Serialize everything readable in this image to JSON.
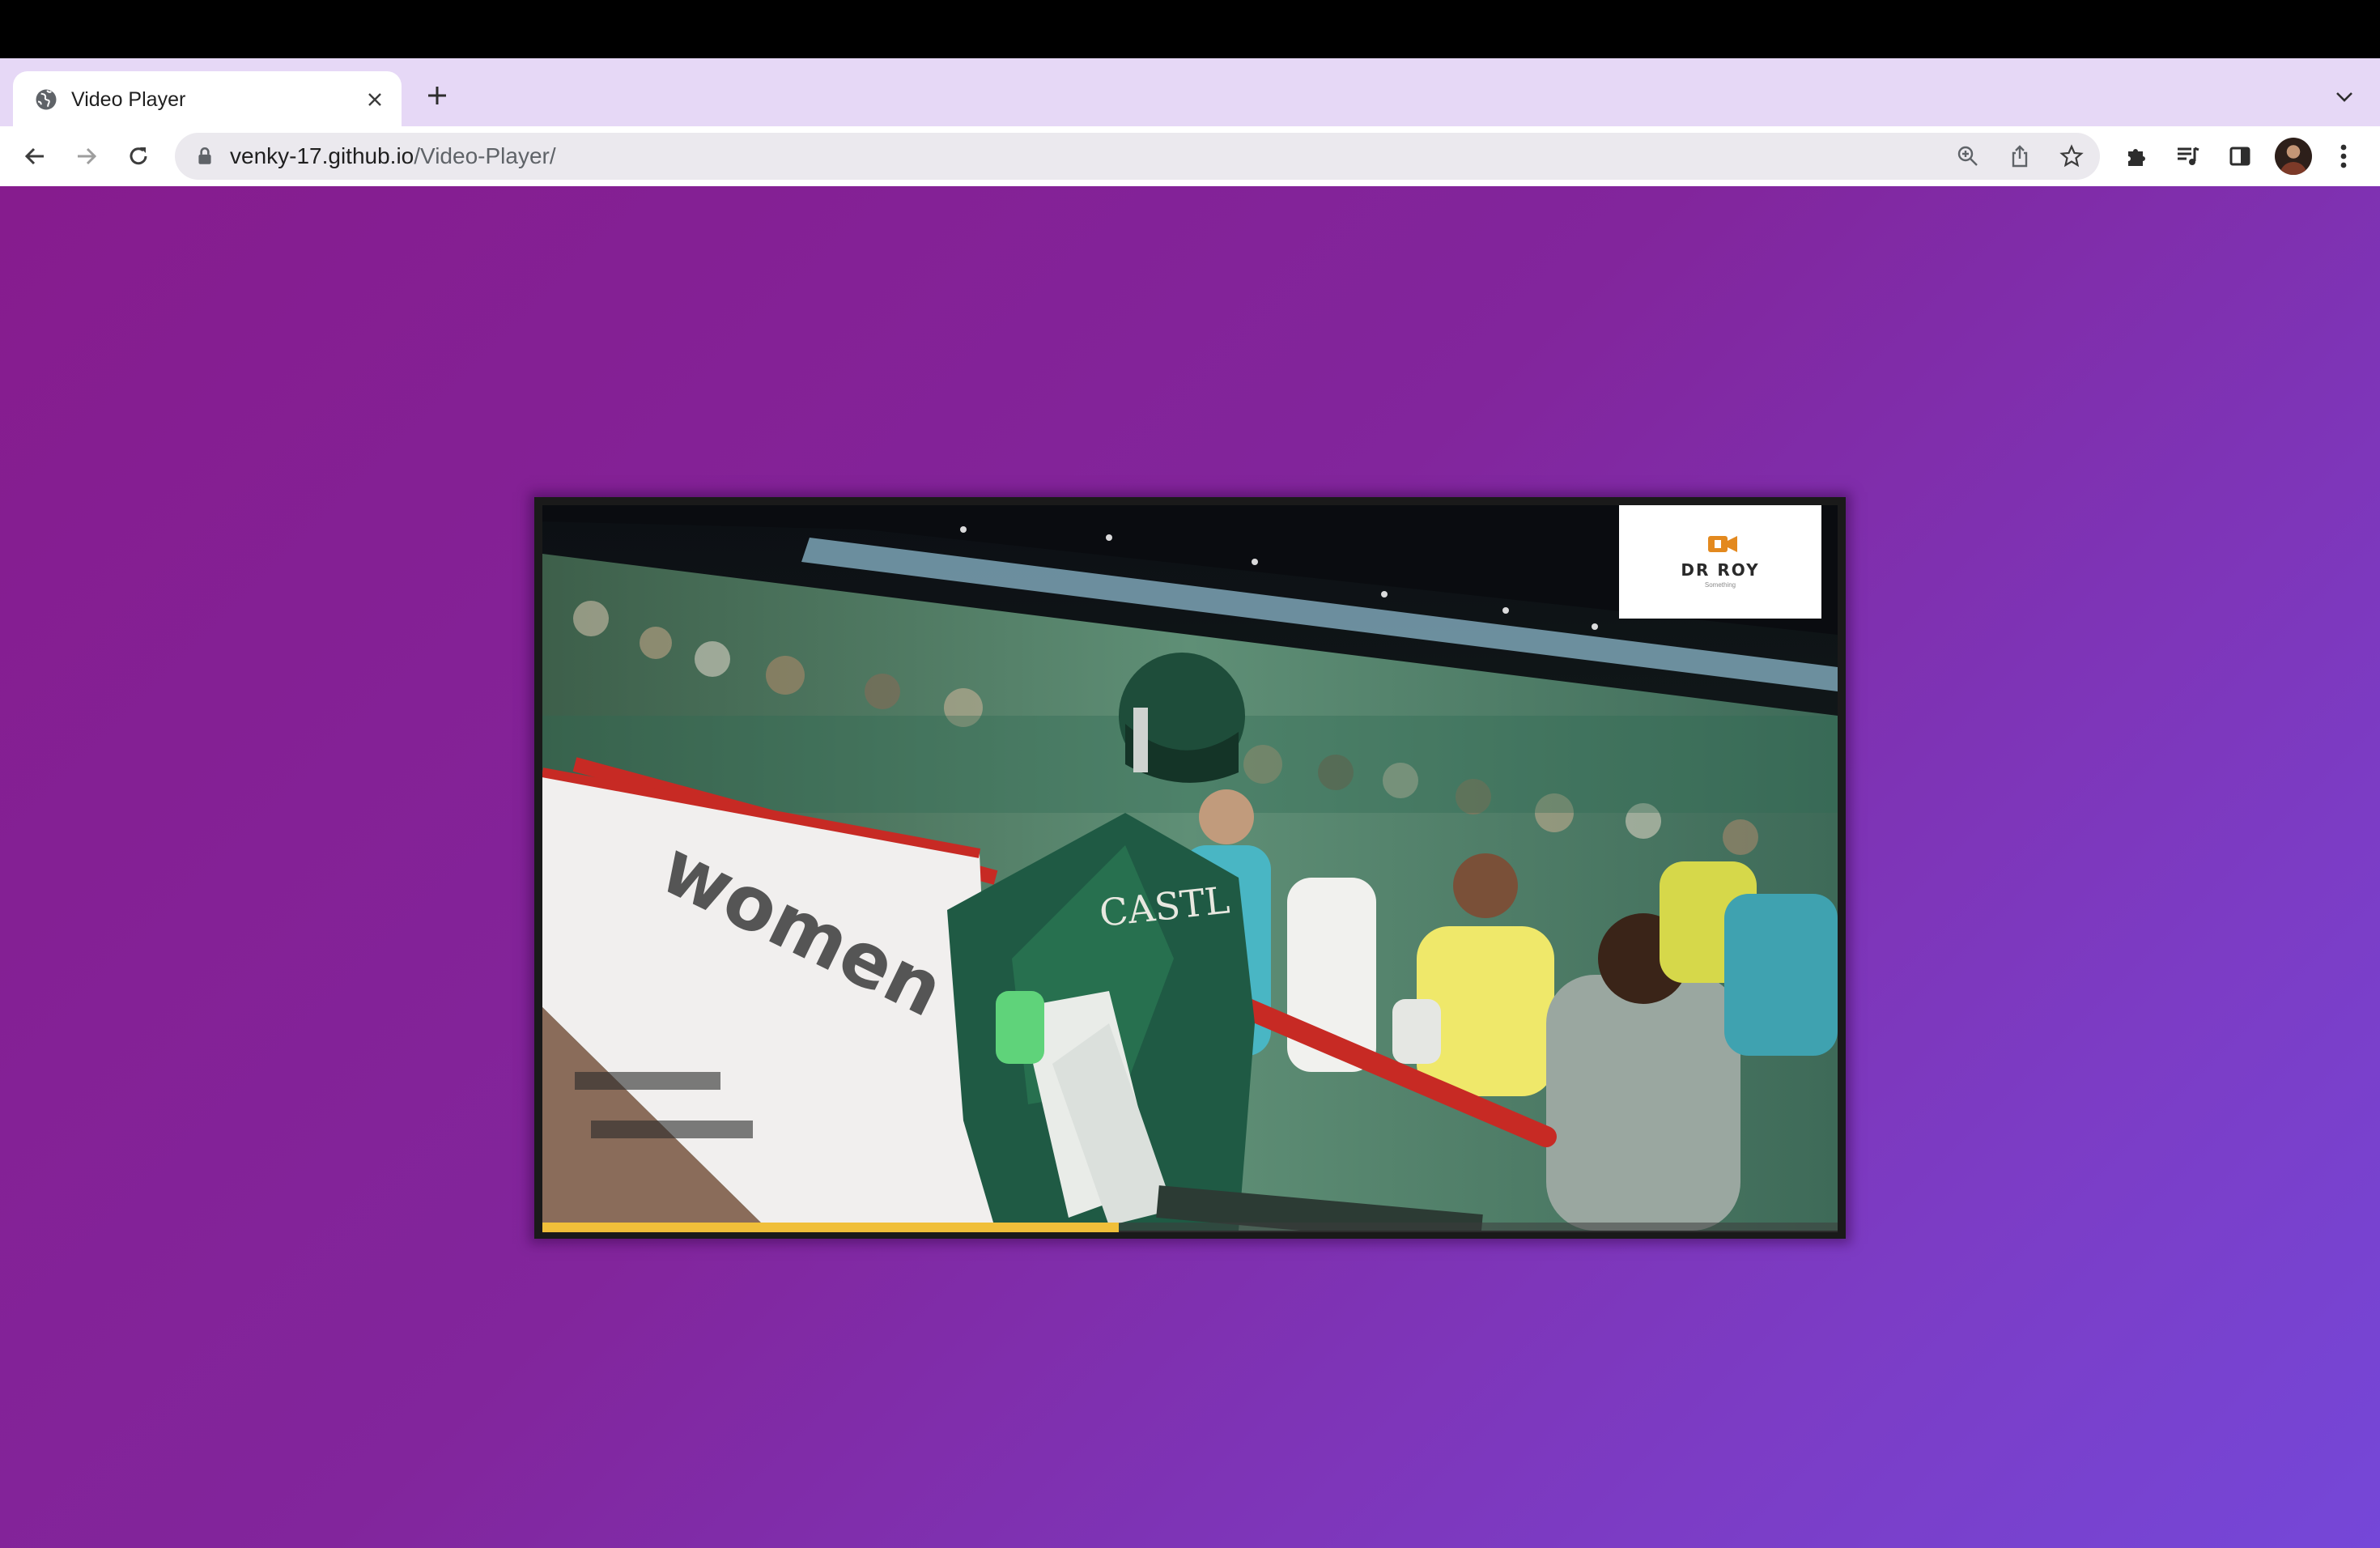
{
  "browser": {
    "tab": {
      "title": "Video Player",
      "favicon": "globe-icon"
    },
    "url": {
      "host": "venky-17.github.io",
      "path": "/Video-Player/"
    },
    "icons": {
      "back": "back-arrow-icon",
      "forward": "forward-arrow-icon",
      "reload": "reload-icon",
      "zoom": "zoom-icon",
      "share": "share-icon",
      "bookmark": "star-icon",
      "extensions": "puzzle-icon",
      "media": "media-queue-icon",
      "side_panel": "side-panel-icon",
      "menu": "kebab-menu-icon"
    },
    "colors": {
      "tab_strip": "#e6d8f6",
      "omnibox": "#ebe9ee"
    }
  },
  "page": {
    "background": [
      "#861c8e",
      "#7547d8"
    ],
    "video": {
      "progress": 0.445,
      "progress_color": "#f0bf3a",
      "watermark": {
        "brand": "DR ROY",
        "tagline": "Something"
      },
      "banner_text": "women"
    }
  }
}
